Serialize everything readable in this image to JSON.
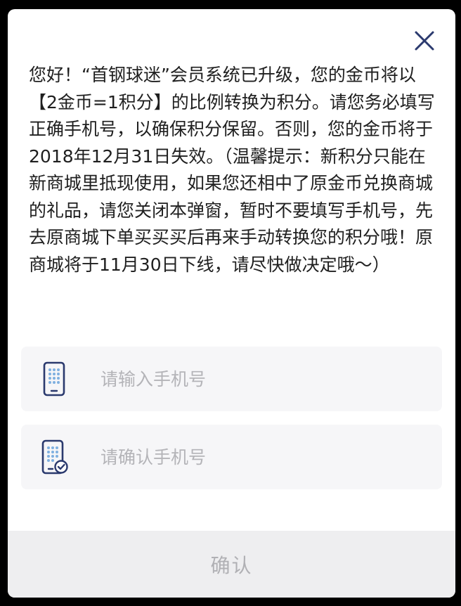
{
  "dialog": {
    "message": "您好！“首钢球迷”会员系统已升级，您的金币将以【2金币=1积分】的比例转换为积分。请您务必填写正确手机号，以确保积分保留。否则，您的金币将于2018年12月31日失效。（温馨提示：新积分只能在新商城里抵现使用，如果您还相中了原金币兑换商城的礼品，请您关闭本弹窗，暂时不要填写手机号，先去原商城下单买买买后再来手动转换您的积分哦！原商城将于11月30日下线，请尽快做决定哦～）",
    "close_icon": "close-icon"
  },
  "form": {
    "phone": {
      "placeholder": "请输入手机号",
      "value": "",
      "icon": "phone-icon"
    },
    "confirm_phone": {
      "placeholder": "请确认手机号",
      "value": "",
      "icon": "phone-check-icon"
    }
  },
  "actions": {
    "confirm_label": "确认"
  },
  "colors": {
    "icon_navy": "#2b3a6e",
    "icon_dots": "#7fb0e0",
    "field_bg": "#f6f6f8",
    "button_bg": "#eeeef0",
    "button_text": "#b0b0b4"
  }
}
